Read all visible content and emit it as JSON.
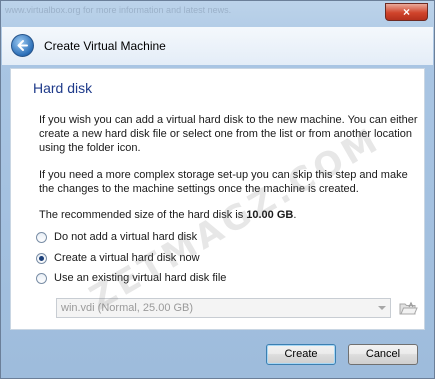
{
  "window": {
    "title": "Create Virtual Machine",
    "close_label": "×"
  },
  "behind_text": "www.virtualbox.org for more information and latest news.",
  "page": {
    "section_title": "Hard disk",
    "paragraph1": "If you wish you can add a virtual hard disk to the new machine. You can either create a new hard disk file or select one from the list or from another location using the folder icon.",
    "paragraph2": "If you need a more complex storage set-up you can skip this step and make the changes to the machine settings once the machine is created.",
    "recommended_prefix": "The recommended size of the hard disk is ",
    "recommended_size": "10.00 GB",
    "recommended_suffix": "."
  },
  "options": {
    "no_disk": "Do not add a virtual hard disk",
    "create_now": "Create a virtual hard disk now",
    "use_existing": "Use an existing virtual hard disk file",
    "selected": "create_now"
  },
  "existing_disk": {
    "value": "win.vdi (Normal, 25.00 GB)"
  },
  "buttons": {
    "create": "Create",
    "cancel": "Cancel"
  },
  "watermark": "ZETMAGZ.COM",
  "icons": {
    "back": "back-arrow-icon",
    "folder": "folder-open-icon",
    "close": "close-icon"
  }
}
